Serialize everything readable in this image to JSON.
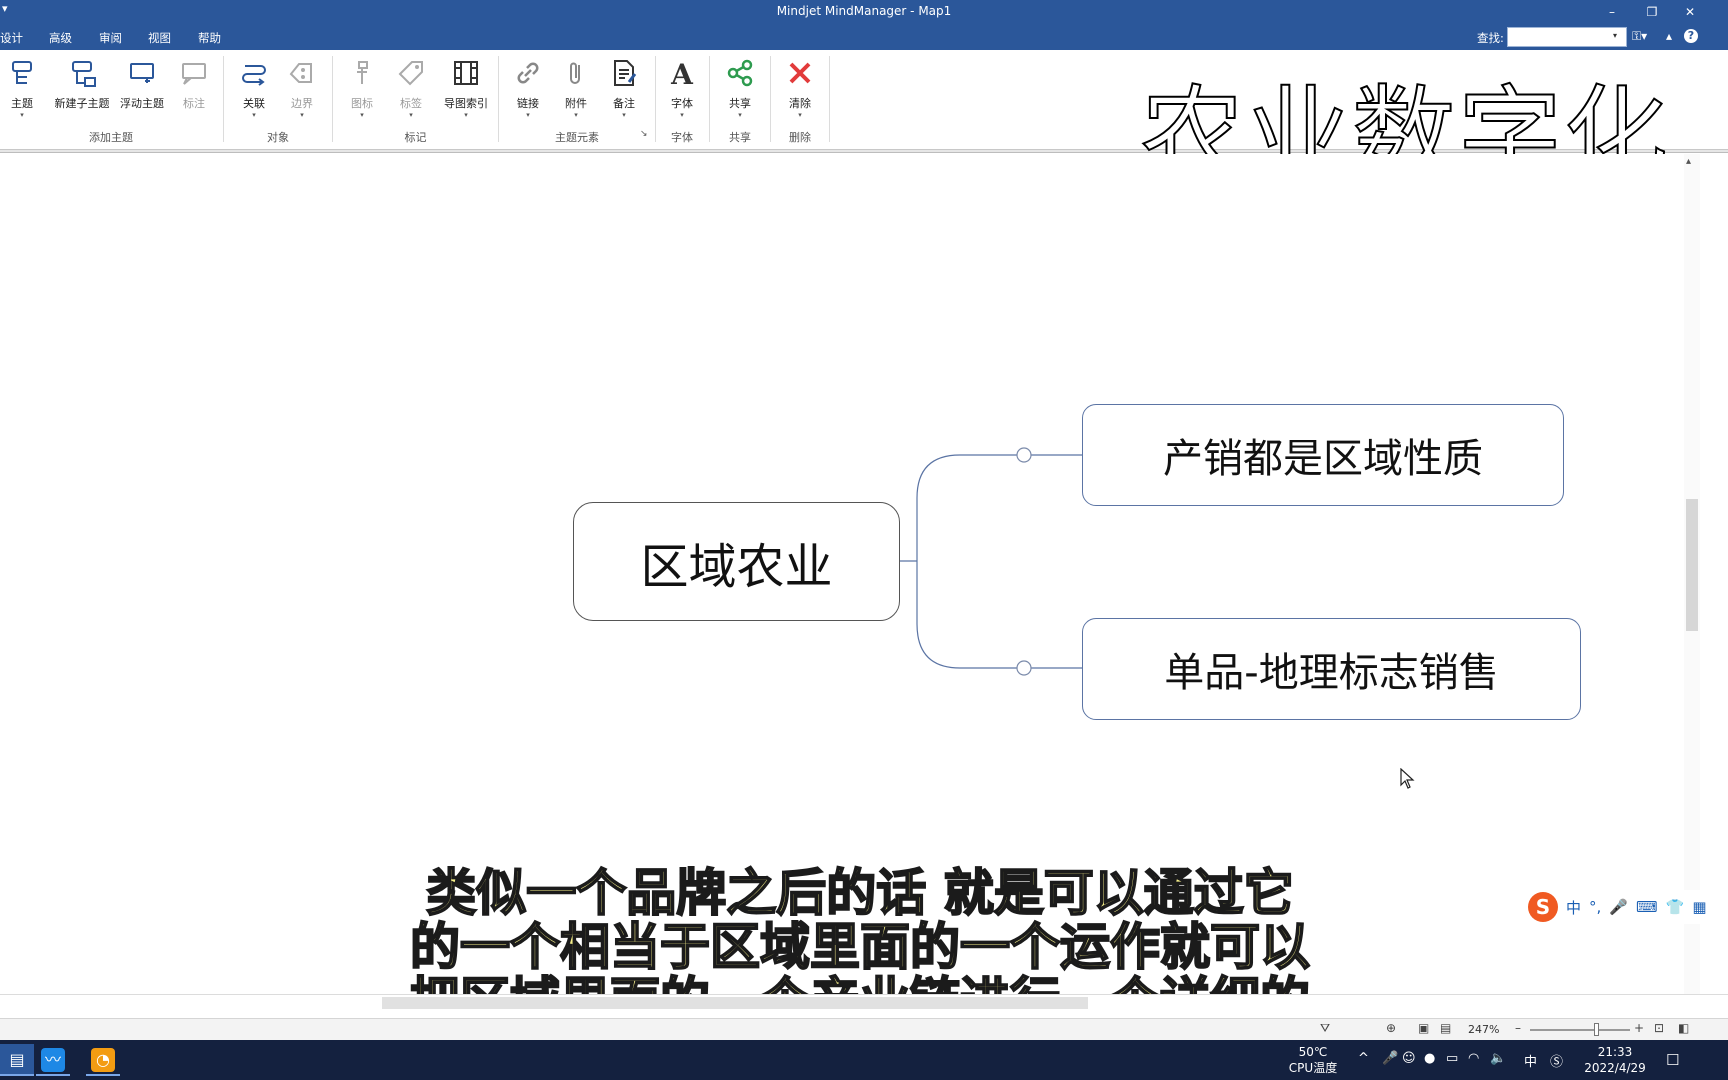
{
  "window": {
    "title": "Mindjet MindManager - Map1",
    "qat": "▾",
    "min": "–",
    "restore": "❐",
    "close": "✕"
  },
  "menu": {
    "items": [
      "设计",
      "高级",
      "审阅",
      "视图",
      "帮助"
    ],
    "find_label": "查找:",
    "find_value": "",
    "find_arrow": "▾",
    "ribbon_toggle": "▴",
    "help": "?",
    "binoculars": "⚿▾"
  },
  "ribbon": {
    "topic": "主题",
    "new_subtopic": "新建子主题",
    "floating_topic": "浮动主题",
    "callout": "标注",
    "relationship": "关联",
    "boundary": "边界",
    "icons": "图标",
    "tags": "标签",
    "map_index": "导图索引",
    "hyperlink": "链接",
    "attachment": "附件",
    "notes": "备注",
    "font": "字体",
    "share": "共享",
    "clear": "清除",
    "dropdown": "▾",
    "group_add_topic": "添加主题",
    "group_objects": "对象",
    "group_markers": "标记",
    "group_topic_elements": "主题元素",
    "group_font": "字体",
    "group_share": "共享",
    "group_delete": "删除",
    "launcher": "↘"
  },
  "watermark": "农业数字化",
  "map": {
    "central": "区域农业",
    "subtopics": [
      "产销都是区域性质",
      "单品-地理标志销售"
    ]
  },
  "ime": {
    "logo": "S",
    "mode": "中",
    "punct": "°,",
    "mic": "🎤",
    "keyboard": "⌨",
    "skin": "👕",
    "apps": "▦"
  },
  "subtitle": [
    "类似一个品牌之后的话  就是可以通过它",
    "的一个相当于区域里面的一个运作就可以",
    "把区域里面的一个产业链进行一个详细的"
  ],
  "status": {
    "zoom": "247%",
    "minus": "–",
    "plus": "+"
  },
  "taskbar": {
    "temp_value": "50℃",
    "temp_label": "CPU温度",
    "ime_mode": "中",
    "time": "21:33",
    "date": "2022/4/29",
    "chevron": "^"
  },
  "colors": {
    "titlebar": "#2b579a",
    "taskbar": "#14213f",
    "topic_border": "#5b74a4",
    "clear_icon": "#e23b3b",
    "subtitle_fill": "#f7f08a"
  }
}
